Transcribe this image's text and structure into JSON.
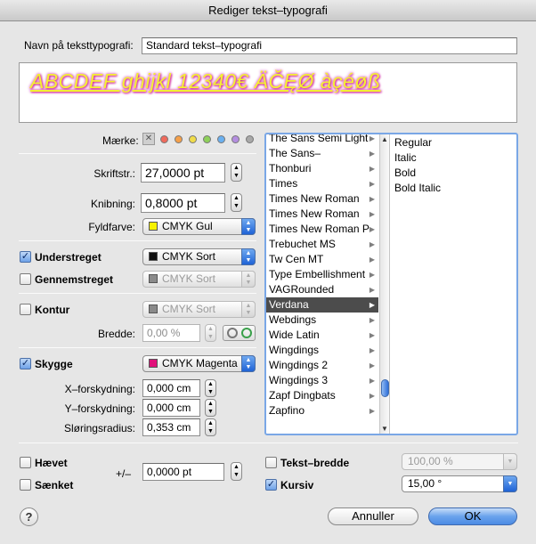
{
  "window": {
    "title": "Rediger tekst–typografi"
  },
  "name": {
    "label": "Navn på teksttypografi:",
    "value": "Standard tekst–typografi"
  },
  "preview": {
    "text": "ABCDEF ghijkl 12340€ ÄČĘØ àçéøß"
  },
  "marker": {
    "label": "Mærke:",
    "clear_glyph": "✕",
    "dots": [
      "#f06a5c",
      "#f5a04a",
      "#f0dc4a",
      "#8ed05a",
      "#6ab0f0",
      "#b48ee0",
      "#a8a8a8"
    ]
  },
  "size": {
    "label": "Skriftstr.:",
    "value": "27,0000 pt"
  },
  "kerning": {
    "label": "Knibning:",
    "value": "0,8000 pt"
  },
  "fill": {
    "label": "Fyldfarve:",
    "value": "CMYK Gul",
    "color": "#f7f200"
  },
  "underline": {
    "label": "Understreget",
    "checked": "✓",
    "color_label": "CMYK Sort",
    "color": "#111111"
  },
  "strike": {
    "label": "Gennemstreget",
    "color_label": "CMYK Sort",
    "color": "#8a8a8a"
  },
  "outline": {
    "label": "Kontur",
    "color_label": "CMYK Sort",
    "color": "#8a8a8a",
    "width_label": "Bredde:",
    "width_value": "0,00 %"
  },
  "shadow": {
    "label": "Skygge",
    "checked": "✓",
    "color_label": "CMYK Magenta",
    "color": "#e0107a",
    "x_label": "X–forskydning:",
    "x_value": "0,000 cm",
    "y_label": "Y–forskydning:",
    "y_value": "0,000 cm",
    "blur_label": "Sløringsradius:",
    "blur_value": "0,353 cm"
  },
  "fonts": {
    "families": [
      "The Sans Semi Light",
      "The Sans–",
      "Thonburi",
      "Times",
      "Times New Roman",
      "Times New Roman",
      "Times New Roman P",
      "Trebuchet MS",
      "Tw Cen MT",
      "Type Embellishment",
      "VAGRounded",
      "Verdana",
      "Webdings",
      "Wide Latin",
      "Wingdings",
      "Wingdings 2",
      "Wingdings 3",
      "Zapf Dingbats",
      "Zapfino"
    ],
    "selected": "Verdana",
    "styles": [
      "Regular",
      "Italic",
      "Bold",
      "Bold Italic"
    ],
    "scroll_position": 0.9
  },
  "raised": {
    "label": "Hævet"
  },
  "lowered": {
    "label": "Sænket"
  },
  "offset": {
    "label": "+/–",
    "value": "0,0000 pt"
  },
  "text_width": {
    "label": "Tekst–bredde",
    "value": "100,00 %"
  },
  "italic": {
    "label": "Kursiv",
    "checked": "✓",
    "value": "15,00 °"
  },
  "buttons": {
    "cancel": "Annuller",
    "ok": "OK",
    "help": "?"
  },
  "glyphs": {
    "up": "▲",
    "down": "▼",
    "right": "▶"
  }
}
